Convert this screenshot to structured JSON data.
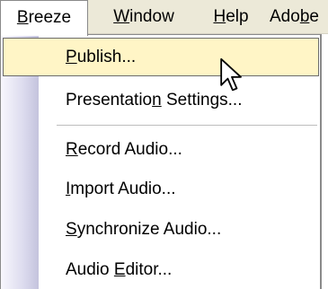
{
  "menubar": {
    "items": [
      {
        "label_before": "",
        "accel": "B",
        "label_after": "reeze",
        "active": true
      },
      {
        "label_before": "",
        "accel": "W",
        "label_after": "indow",
        "active": false
      },
      {
        "label_before": "",
        "accel": "H",
        "label_after": "elp",
        "active": false
      },
      {
        "label_before": "Ado",
        "accel": "b",
        "label_after": "e",
        "active": false
      }
    ]
  },
  "menu": {
    "items": [
      {
        "label_before": "",
        "accel": "P",
        "label_after": "ublish...",
        "highlighted": true
      },
      {
        "label_before": "Presentatio",
        "accel": "n",
        "label_after": " Settings...",
        "highlighted": false
      },
      {
        "label_before": "",
        "accel": "R",
        "label_after": "ecord Audio...",
        "highlighted": false
      },
      {
        "label_before": "",
        "accel": "I",
        "label_after": "mport Audio...",
        "highlighted": false
      },
      {
        "label_before": "",
        "accel": "S",
        "label_after": "ynchronize Audio...",
        "highlighted": false
      },
      {
        "label_before": "Audio ",
        "accel": "E",
        "label_after": "ditor...",
        "highlighted": false
      }
    ]
  },
  "colors": {
    "menubar_bg": "#ece9d8",
    "highlight_bg": "#fff5c6",
    "highlight_border": "#6b6b6b",
    "icon_strip": "#c4c3dd"
  },
  "cursor": {
    "icon": "arrow-pointer-icon"
  }
}
